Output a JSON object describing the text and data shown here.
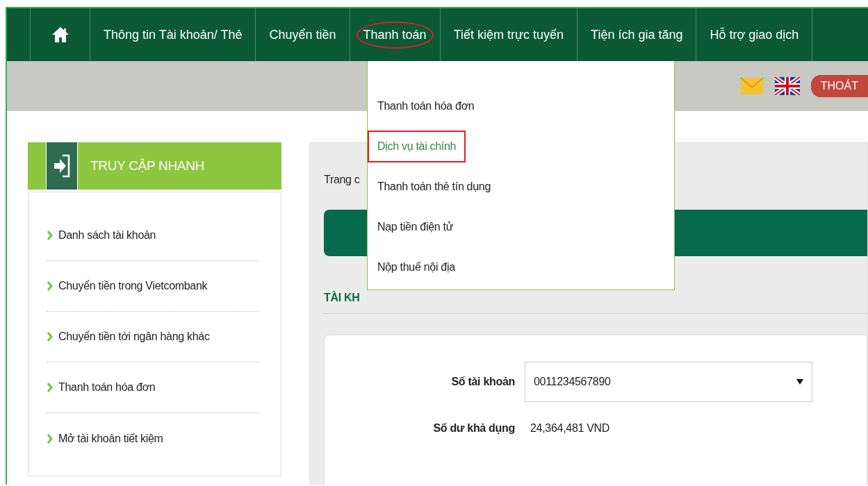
{
  "nav": {
    "items": [
      {
        "kind": "home",
        "selected": false
      },
      {
        "kind": "text",
        "label": "Thông tin Tài khoản/ Thẻ",
        "selected": false
      },
      {
        "kind": "text",
        "label": "Chuyển tiền",
        "selected": false
      },
      {
        "kind": "text",
        "label": "Thanh toán",
        "selected": true
      },
      {
        "kind": "text",
        "label": "Tiết kiệm trực tuyến",
        "selected": false
      },
      {
        "kind": "text",
        "label": "Tiện ích gia tăng",
        "selected": false
      },
      {
        "kind": "text",
        "label": "Hỗ trợ giao dịch",
        "selected": false
      }
    ]
  },
  "header": {
    "logout": "THOÁT"
  },
  "dropdown": {
    "items": [
      {
        "label": "Thanh toán hóa đơn",
        "selected": false
      },
      {
        "label": "Dịch vụ tài chính",
        "selected": true
      },
      {
        "label": "Thanh toán thẻ tín dụng",
        "selected": false
      },
      {
        "label": "Nạp tiền điện tử",
        "selected": false
      },
      {
        "label": "Nộp thuế nội địa",
        "selected": false
      }
    ]
  },
  "sidebar": {
    "title": "TRUY CẬP NHANH",
    "items": [
      "Danh sách tài khoản",
      "Chuyển tiền trong Vietcombank",
      "Chuyển tiền tới ngân hàng khác",
      "Thanh toán hóa đơn",
      "Mở tài khoản tiết kiệm"
    ]
  },
  "main": {
    "breadcrumb": "Trang c",
    "section_title": "TÀI KH",
    "account_label": "Số tài khoản",
    "account_value": "0011234567890",
    "balance_label": "Số dư khả dụng",
    "balance_value": "24,364,481 VND"
  }
}
